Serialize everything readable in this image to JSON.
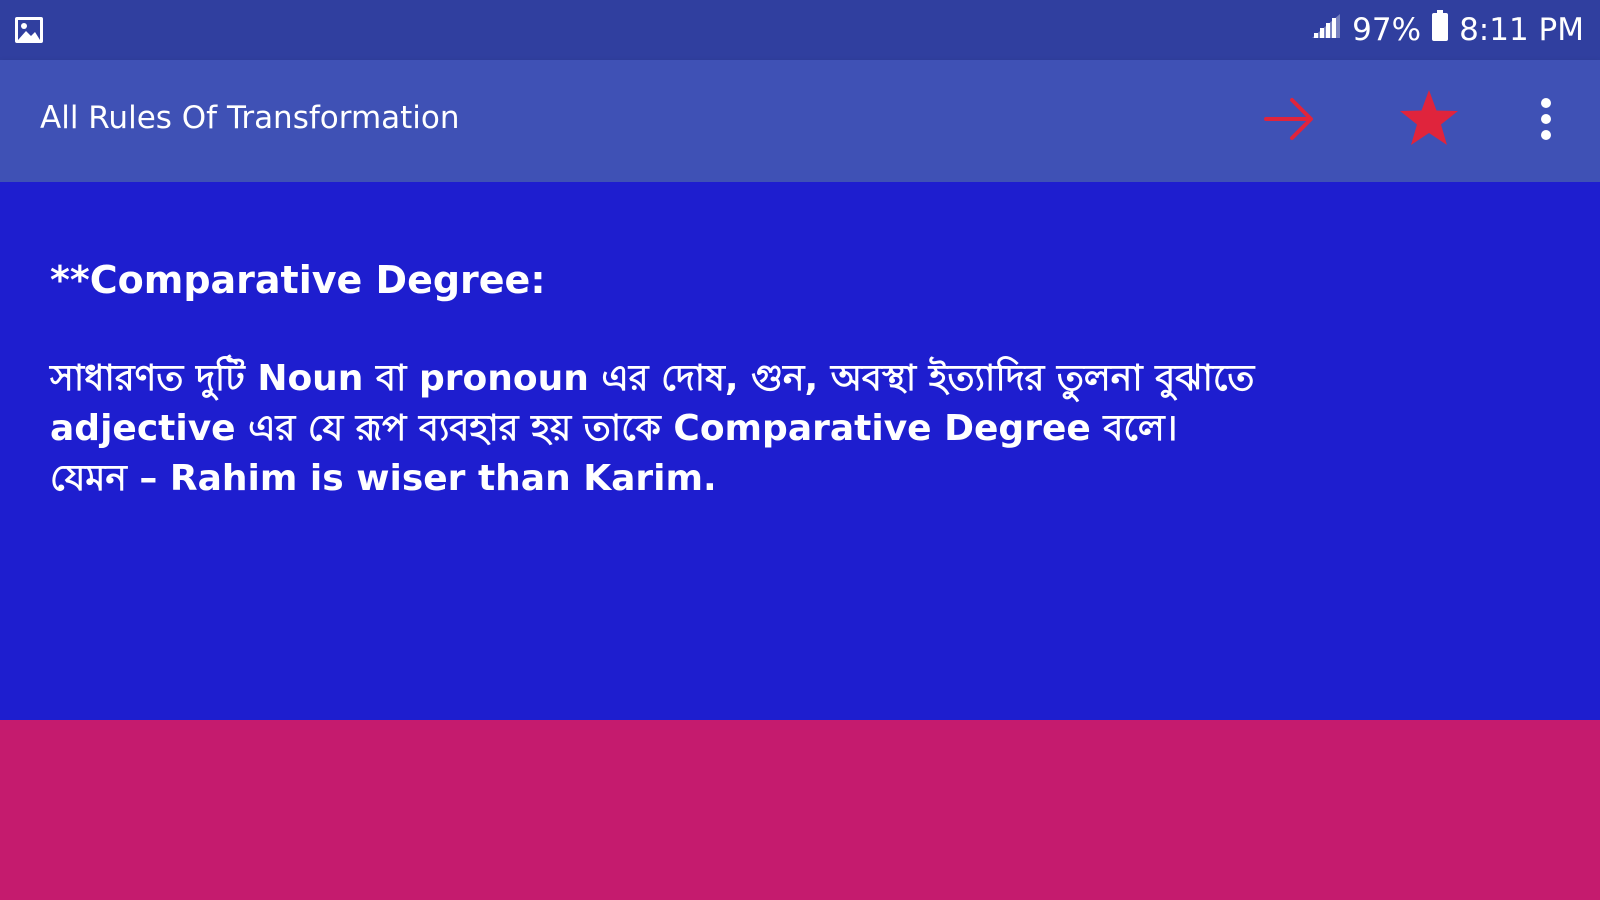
{
  "status_bar": {
    "battery": "97%",
    "time": "8:11 PM",
    "left_icon": "image-icon",
    "signal_icon": "signal-icon",
    "battery_icon": "battery-icon"
  },
  "app_bar": {
    "title": "All Rules Of Transformation",
    "actions": [
      {
        "icon": "arrow-right-icon",
        "color": "#e0243c"
      },
      {
        "icon": "star-icon",
        "color": "#e0243c"
      },
      {
        "icon": "more-vert-icon",
        "color": "#ffffff"
      }
    ]
  },
  "content": {
    "heading": "**Comparative Degree:",
    "lines": [
      "সাধারণত দুটি Noun বা pronoun এর দোষ, গুন, অবস্থা ইত্যাদির তুলনা বুঝাতে",
      "adjective এর যে রূপ ব্যবহার হয় তাকে Comparative Degree বলে।",
      "যেমন – Rahim is wiser than Karim."
    ]
  },
  "colors": {
    "status_bar": "#303f9f",
    "app_bar": "#3f51b5",
    "content_bg": "#1e1ecf",
    "footer_bg": "#c51b6e",
    "accent": "#e0243c"
  }
}
